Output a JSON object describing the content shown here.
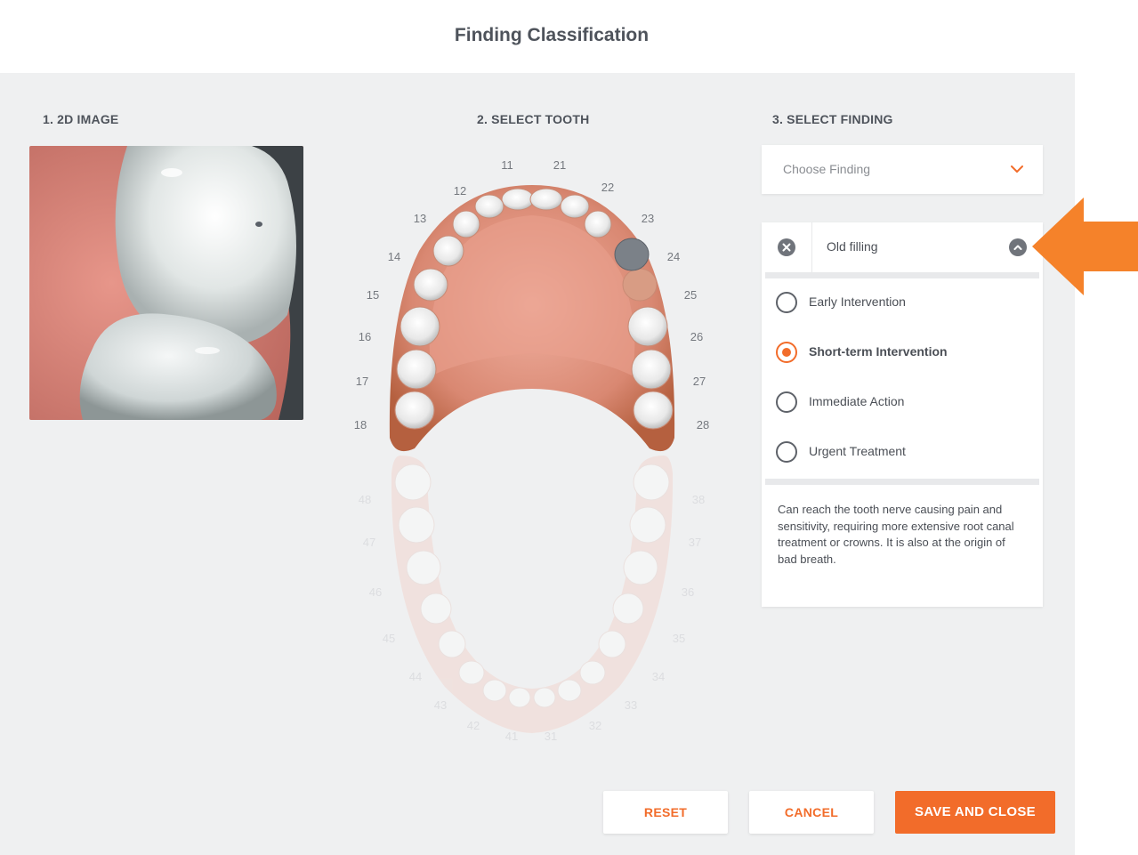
{
  "header": {
    "title": "Finding Classification"
  },
  "columns": {
    "image_heading": "1. 2D IMAGE",
    "tooth_heading": "2. SELECT TOOTH",
    "finding_heading": "3. SELECT FINDING"
  },
  "tooth_chart": {
    "upper_labels": [
      "11",
      "21",
      "12",
      "22",
      "13",
      "23",
      "14",
      "24",
      "15",
      "25",
      "16",
      "26",
      "17",
      "27",
      "18",
      "28"
    ],
    "lower_labels": [
      "48",
      "38",
      "47",
      "37",
      "46",
      "36",
      "45",
      "35",
      "44",
      "34",
      "43",
      "33",
      "42",
      "32",
      "41",
      "31"
    ],
    "selected_tooth": "24"
  },
  "finding_select": {
    "placeholder": "Choose Finding"
  },
  "finding_panel": {
    "name": "Old filling",
    "options": [
      {
        "label": "Early Intervention",
        "selected": false
      },
      {
        "label": "Short-term Intervention",
        "selected": true
      },
      {
        "label": "Immediate Action",
        "selected": false
      },
      {
        "label": "Urgent Treatment",
        "selected": false
      }
    ],
    "description": "Can reach the tooth nerve causing pain and sensitivity, requiring more extensive root canal treatment or crowns. It is also at the origin of bad breath."
  },
  "buttons": {
    "reset": "RESET",
    "cancel": "CANCEL",
    "save": "SAVE AND CLOSE"
  },
  "colors": {
    "accent": "#f26c2a",
    "background": "#eff0f1",
    "text": "#4b4f56"
  }
}
